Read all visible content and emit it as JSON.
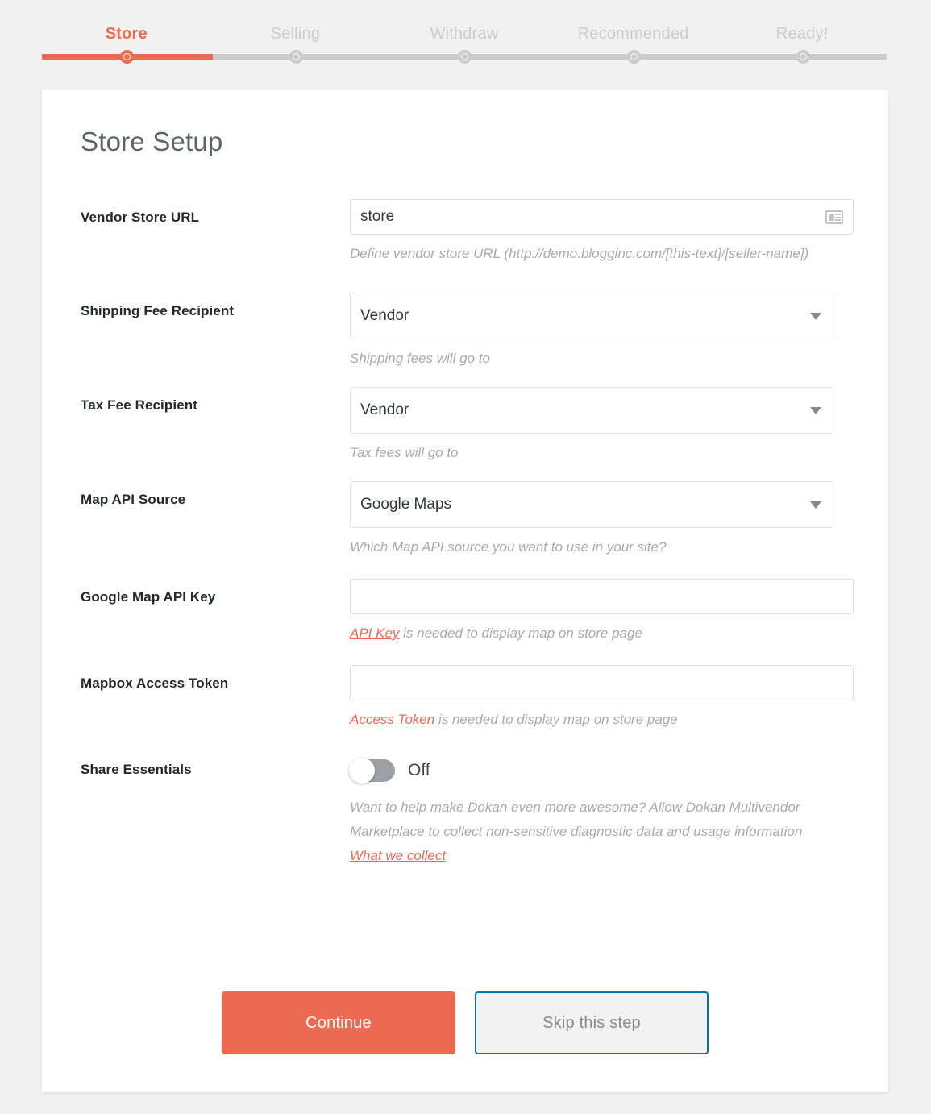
{
  "colors": {
    "accent": "#ec6a51",
    "step_inactive": "#cccccc",
    "skip_border": "#0073aa",
    "page_bg": "#f1f1f1",
    "card_bg": "#ffffff",
    "label_text": "#23282d",
    "desc_text": "#aaaaaa"
  },
  "stepper": {
    "steps": [
      {
        "label": "Store",
        "state": "active"
      },
      {
        "label": "Selling",
        "state": "upcoming"
      },
      {
        "label": "Withdraw",
        "state": "upcoming"
      },
      {
        "label": "Recommended",
        "state": "upcoming"
      },
      {
        "label": "Ready!",
        "state": "upcoming"
      }
    ],
    "progress_percent": 20
  },
  "card": {
    "title": "Store Setup",
    "fields": [
      {
        "label": "Vendor Store URL",
        "type": "text",
        "value": "store",
        "placeholder": "",
        "icon": "id-card-icon",
        "description": "Define vendor store URL (http://demo.blogginc.com/[this-text]/[seller-name])"
      },
      {
        "label": "Shipping Fee Recipient",
        "type": "select",
        "value": "Vendor",
        "description": "Shipping fees will go to"
      },
      {
        "label": "Tax Fee Recipient",
        "type": "select",
        "value": "Vendor",
        "description": "Tax fees will go to"
      },
      {
        "label": "Map API Source",
        "type": "select",
        "value": "Google Maps",
        "description": "Which Map API source you want to use in your site?"
      },
      {
        "label": "Google Map API Key",
        "type": "text",
        "value": "",
        "placeholder": "",
        "description_link": "API Key",
        "description_rest": " is needed to display map on store page"
      },
      {
        "label": "Mapbox Access Token",
        "type": "text",
        "value": "",
        "placeholder": "",
        "description_link": "Access Token",
        "description_rest": " is needed to display map on store page"
      },
      {
        "label": "Share Essentials",
        "type": "toggle",
        "toggle_state": "Off",
        "description_rest": "Want to help make Dokan even more awesome? Allow Dokan Multivendor Marketplace to collect non-sensitive diagnostic data and usage information ",
        "description_link": "What we collect"
      }
    ],
    "actions": {
      "primary_label": "Continue",
      "skip_label": "Skip this step"
    }
  }
}
